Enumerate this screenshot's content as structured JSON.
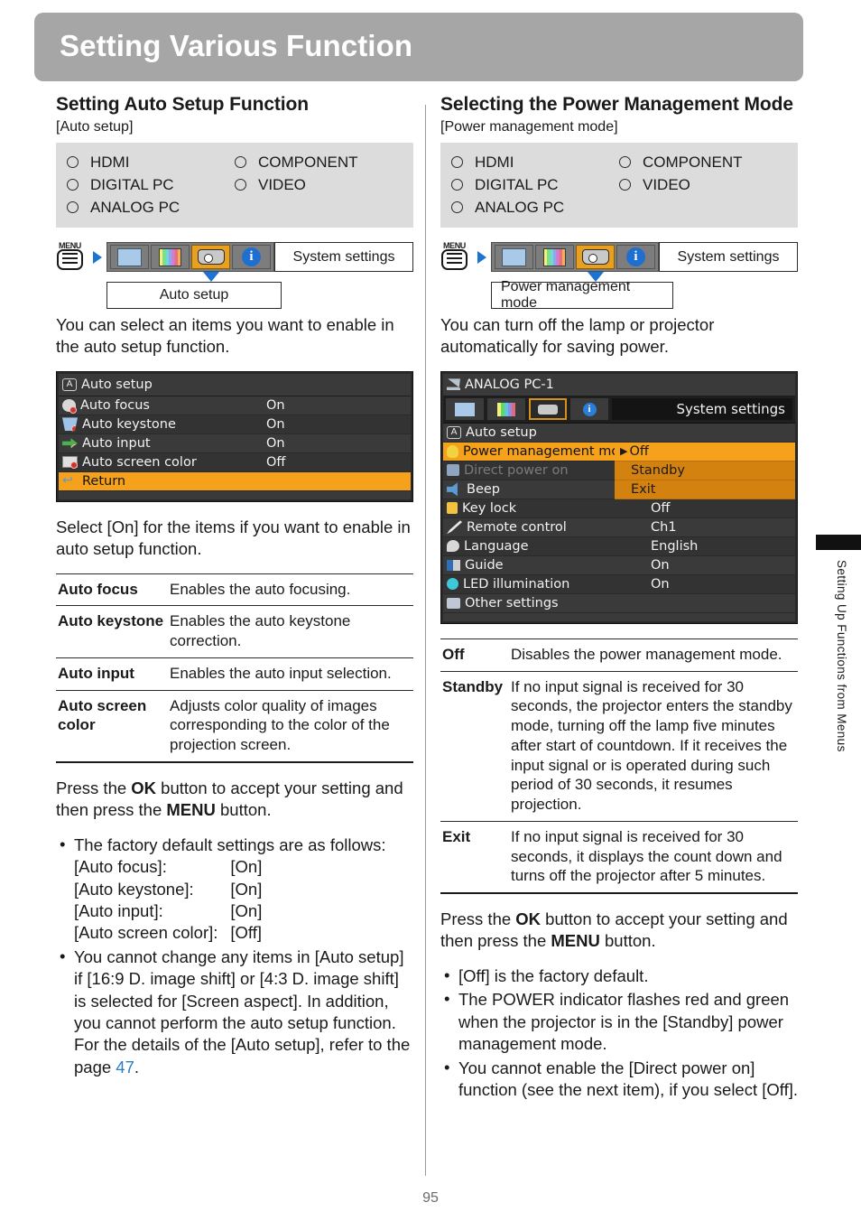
{
  "header": {
    "title": "Setting Various Function"
  },
  "page": {
    "number": "95"
  },
  "sidetab": {
    "label": "Setting Up Functions from Menus"
  },
  "left": {
    "section_title": "Setting Auto Setup Function",
    "bracket_name": "[Auto setup]",
    "sources": {
      "col1": [
        "HDMI",
        "DIGITAL PC",
        "ANALOG PC"
      ],
      "col2": [
        "COMPONENT",
        "VIDEO"
      ]
    },
    "nav": {
      "menu_label": "MENU",
      "tabs": [
        "screen-tab-icon",
        "color-tab-icon",
        "projector-tab-icon",
        "info-tab-icon"
      ],
      "selected_tab": "projector-tab-icon",
      "category": "System settings",
      "submenu": "Auto setup"
    },
    "intro": "You can select an items you want to enable in the auto setup function.",
    "osd": {
      "title": "Auto setup",
      "rows": [
        {
          "label": "Auto focus",
          "value": "On",
          "icon": "auto-focus-icon"
        },
        {
          "label": "Auto keystone",
          "value": "On",
          "icon": "auto-keystone-icon"
        },
        {
          "label": "Auto input",
          "value": "On",
          "icon": "auto-input-icon"
        },
        {
          "label": "Auto screen color",
          "value": "Off",
          "icon": "auto-screen-color-icon"
        },
        {
          "label": "Return",
          "value": "",
          "icon": "return-icon"
        }
      ],
      "highlight_color": "#f5a11b"
    },
    "after_osd": "Select [On] for the items if you want to enable in auto setup function.",
    "table": [
      {
        "term": "Auto focus",
        "desc": "Enables the auto focusing."
      },
      {
        "term": "Auto keystone",
        "desc": "Enables the auto keystone correction."
      },
      {
        "term": "Auto input",
        "desc": "Enables the auto input selection."
      },
      {
        "term": "Auto screen color",
        "desc": "Adjusts color quality of images corresponding to the color of the projection screen."
      }
    ],
    "press_ok": {
      "prefix": "Press the ",
      "ok": "OK",
      "middle": " button to accept your setting and then press the ",
      "menu": "MENU",
      "suffix": " button."
    },
    "notes": [
      {
        "type": "defaults",
        "lead": "The factory default settings are as follows:",
        "pairs": [
          {
            "key": "[Auto focus]:",
            "value": "[On]"
          },
          {
            "key": "[Auto keystone]:",
            "value": "[On]"
          },
          {
            "key": "[Auto input]:",
            "value": "[On]"
          },
          {
            "key": "[Auto screen color]:",
            "value": "[Off]"
          }
        ]
      },
      {
        "type": "text_with_link",
        "text_before": "You cannot change any items in [Auto setup] if [16:9 D. image shift] or [4:3 D. image shift] is selected for [Screen aspect]. In addition, you cannot perform the auto setup function. For the details of the [Auto setup], refer to the page ",
        "link": "47",
        "text_after": "."
      }
    ]
  },
  "right": {
    "section_title": "Selecting the Power Management Mode",
    "bracket_name": "[Power management mode]",
    "sources": {
      "col1": [
        "HDMI",
        "DIGITAL PC",
        "ANALOG PC"
      ],
      "col2": [
        "COMPONENT",
        "VIDEO"
      ]
    },
    "nav": {
      "menu_label": "MENU",
      "tabs": [
        "screen-tab-icon",
        "color-tab-icon",
        "projector-tab-icon",
        "info-tab-icon"
      ],
      "selected_tab": "projector-tab-icon",
      "category": "System settings",
      "submenu": "Power management mode"
    },
    "intro": "You can turn off the lamp or projector automatically for saving power.",
    "osd": {
      "input_label": "ANALOG PC-1",
      "category": "System settings",
      "rows": [
        {
          "label": "Auto setup",
          "value": "",
          "icon": "auto-setup-icon",
          "state": "normal"
        },
        {
          "label": "Power management mode",
          "value": "",
          "icon": "power-management-icon",
          "state": "highlight"
        },
        {
          "label": "Direct power on",
          "value": "",
          "icon": "direct-power-icon",
          "state": "dimmed"
        },
        {
          "label": "Beep",
          "value": "",
          "icon": "beep-icon",
          "state": "normal"
        },
        {
          "label": "Key lock",
          "value": "Off",
          "icon": "key-lock-icon",
          "state": "normal"
        },
        {
          "label": "Remote control",
          "value": "Ch1",
          "icon": "remote-control-icon",
          "state": "normal"
        },
        {
          "label": "Language",
          "value": "English",
          "icon": "language-icon",
          "state": "normal"
        },
        {
          "label": "Guide",
          "value": "On",
          "icon": "guide-icon",
          "state": "normal"
        },
        {
          "label": "LED illumination",
          "value": "On",
          "icon": "led-icon",
          "state": "normal"
        },
        {
          "label": "Other settings",
          "value": "",
          "icon": "other-settings-icon",
          "state": "normal"
        }
      ],
      "dropdown": {
        "items": [
          "Off",
          "Standby",
          "Exit"
        ],
        "selected": "Off",
        "marker": "▶"
      }
    },
    "table": [
      {
        "term": "Off",
        "desc": "Disables the power management mode."
      },
      {
        "term": "Standby",
        "desc": "If no input signal is received for 30 seconds, the projector enters the standby mode, turning off the lamp five minutes after start of countdown. If it receives the input signal or is operated during such period of 30 seconds, it resumes projection."
      },
      {
        "term": "Exit",
        "desc": "If no input signal is received for 30 seconds, it displays the count down and turns off the projector after 5 minutes."
      }
    ],
    "press_ok": {
      "prefix": "Press the ",
      "ok": "OK",
      "middle": " button to accept your setting and then press the ",
      "menu": "MENU",
      "suffix": " button."
    },
    "notes": [
      "[Off] is the factory default.",
      "The POWER indicator flashes red and green when the projector is in the [Standby] power management mode.",
      "You cannot enable the [Direct power on] function (see the next item), if you select [Off]."
    ]
  }
}
